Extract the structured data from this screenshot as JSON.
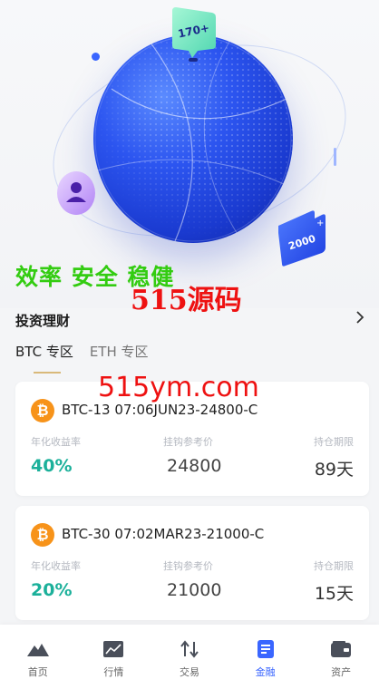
{
  "hero": {
    "badge_top": "170+",
    "badge_bottom": "2000"
  },
  "slogan": "效率 安全 稳健",
  "watermarks": {
    "primary": "515源码",
    "secondary": "515ym.com"
  },
  "section": {
    "title": "投资理财",
    "arrow_icon": "chevron-right-icon"
  },
  "tabs": [
    {
      "label": "BTC 专区",
      "active": true
    },
    {
      "label": "ETH 专区",
      "active": false
    }
  ],
  "cards": [
    {
      "coin_symbol": "₿",
      "title": "BTC-13 07:06JUN23-24800-C",
      "labels": {
        "yield": "年化收益率",
        "price": "挂钩参考价",
        "term": "持仓期限"
      },
      "values": {
        "yield": "40%",
        "price": "24800",
        "term": "89天"
      }
    },
    {
      "coin_symbol": "₿",
      "title": "BTC-30 07:02MAR23-21000-C",
      "labels": {
        "yield": "年化收益率",
        "price": "挂钩参考价",
        "term": "持仓期限"
      },
      "values": {
        "yield": "20%",
        "price": "21000",
        "term": "15天"
      }
    }
  ],
  "tabbar": [
    {
      "label": "首页",
      "icon": "home-mountain-icon",
      "active": false
    },
    {
      "label": "行情",
      "icon": "market-chart-icon",
      "active": false
    },
    {
      "label": "交易",
      "icon": "trade-arrows-icon",
      "active": false
    },
    {
      "label": "金融",
      "icon": "finance-doc-icon",
      "active": true
    },
    {
      "label": "资产",
      "icon": "wallet-icon",
      "active": false
    }
  ],
  "colors": {
    "accent": "#3a66ff",
    "yield_green": "#1bb09a",
    "slogan_green": "#33cc11",
    "watermark_red": "#ee1111",
    "btc_orange": "#f7931a"
  }
}
